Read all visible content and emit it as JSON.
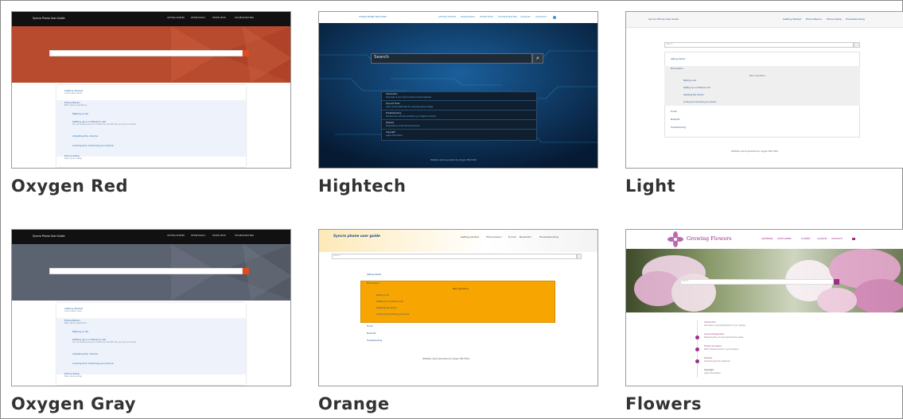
{
  "themes": [
    {
      "caption": "Oxygen Red",
      "site_title": "Syncro Phone User Guide",
      "nav": [
        "GETTING STARTED",
        "PHONE BASICS",
        "PHONE SETUP",
        "TROUBLESHOOTING"
      ],
      "toc": [
        {
          "title": "Getting Started",
          "desc": "Lorem ipsum dolor"
        },
        {
          "title": "Phone Basics",
          "desc": "Basic phone operations"
        },
        {
          "title": "Making a call",
          "desc": ""
        },
        {
          "title": "Setting up a conference call",
          "desc": "You can easily set up a conference call with the your Syncro Phone"
        },
        {
          "title": "Adjusting the volume",
          "desc": ""
        },
        {
          "title": "Locking and unlocking your phone",
          "desc": ""
        },
        {
          "title": "Phone Setup",
          "desc": "Basic phone setup"
        }
      ],
      "colors": {
        "hero": "#b84a2e",
        "header": "#111111"
      }
    },
    {
      "caption": "Hightech",
      "site_title": "SYNCRO PHONE USER GUIDE",
      "nav": [
        "GETTING STARTED",
        "PHONE BASICS",
        "PHONE SETUP",
        "TROUBLESHOOTING",
        "GLOSSARY",
        "COPYRIGHT"
      ],
      "search_placeholder": "Search",
      "toc": [
        {
          "title": "Introduction",
          "desc": "Overview of your Syncro phone and its features"
        },
        {
          "title": "Tips and Tricks",
          "desc": "Learn some useful tips for everyday phone usage"
        },
        {
          "title": "Troubleshooting",
          "desc": "Solutions to common problems you might encounter"
        },
        {
          "title": "Glossary",
          "desc": "Explanations of the technical terms"
        },
        {
          "title": "Copyright",
          "desc": "Legal information"
        }
      ],
      "footer": "Website output generated by oXygen XML Editor",
      "colors": {
        "bg": "#0b2a50"
      }
    },
    {
      "caption": "Light",
      "site_title": "Syncro Phone User Guide",
      "nav": [
        "Getting Started",
        "Phone Basics",
        "Phone Setup",
        "Troubleshooting"
      ],
      "search_placeholder": "Search",
      "toc": [
        {
          "title": "Getting started",
          "level": 0
        },
        {
          "title": "Phone basics",
          "level": 0
        },
        {
          "title": "Basic operations",
          "level": 2
        },
        {
          "title": "Making a call",
          "level": 1
        },
        {
          "title": "Setting up a conference call",
          "level": 1
        },
        {
          "title": "Adjusting the volume",
          "level": 1
        },
        {
          "title": "Locking and unlocking your phone",
          "level": 1
        },
        {
          "title": "E-mail",
          "level": 0
        },
        {
          "title": "Bluetooth",
          "level": 0
        },
        {
          "title": "Troubleshooting",
          "level": 0
        }
      ],
      "footer": "WebHelp output generated by oXygen XML Editor"
    },
    {
      "caption": "Oxygen Gray",
      "site_title": "Syncro Phone User Guide",
      "nav": [
        "GETTING STARTED",
        "PHONE BASICS",
        "PHONE SETUP",
        "TROUBLESHOOTING"
      ],
      "toc": [
        {
          "title": "Getting Started",
          "desc": "Lorem ipsum dolor"
        },
        {
          "title": "Phone Basics",
          "desc": "Basic phone operations"
        },
        {
          "title": "Making a call",
          "desc": ""
        },
        {
          "title": "Setting up a conference call",
          "desc": "You can easily set up a conference call with the your Syncro Phone"
        },
        {
          "title": "Adjusting the volume",
          "desc": ""
        },
        {
          "title": "Locking and unlocking your phone",
          "desc": ""
        },
        {
          "title": "Phone Setup",
          "desc": "Basic phone setup"
        }
      ],
      "colors": {
        "hero": "#5c6370",
        "header": "#111111"
      }
    },
    {
      "caption": "Orange",
      "site_title": "Syncro phone user guide",
      "nav": [
        "Getting started",
        "Phone basics",
        "E-mail",
        "Bluetooth",
        "Troubleshooting"
      ],
      "search_placeholder": "Search",
      "toc": [
        {
          "title": "Getting started",
          "level": 0
        },
        {
          "title": "Phone basics",
          "level": 0
        },
        {
          "title": "Basic operations",
          "level": 2
        },
        {
          "title": "Making a call",
          "level": 1
        },
        {
          "title": "Setting up a conference call",
          "level": 1
        },
        {
          "title": "Adjusting the volume",
          "level": 1
        },
        {
          "title": "Locking and unlocking your phone",
          "level": 1
        },
        {
          "title": "E-mail",
          "level": 0
        },
        {
          "title": "Bluetooth",
          "level": 0
        },
        {
          "title": "Troubleshooting",
          "level": 0
        }
      ],
      "footer": "WebHelp output generated by oXygen XML Editor",
      "colors": {
        "accent": "#f7a500"
      }
    },
    {
      "caption": "Flowers",
      "site_title": "Growing Flowers",
      "nav": [
        "GARDENING",
        "WILDFLOWERS",
        "FLOWERS",
        "GLOSSARY",
        "COPYRIGHT"
      ],
      "search_placeholder": "Search",
      "toc": [
        {
          "title": "Introduction",
          "desc": "Overview of growing flowers in your garden"
        },
        {
          "title": "Care and Preparation",
          "desc": "Preparing the soil and planting the seeds"
        },
        {
          "title": "Flowers by Season",
          "desc": "Which flowers bloom in each season"
        },
        {
          "title": "Glossary",
          "desc": "Gardening terms explained"
        },
        {
          "title": "Copyright",
          "desc": "Legal information"
        }
      ],
      "colors": {
        "accent": "#9c2f8c"
      }
    }
  ]
}
